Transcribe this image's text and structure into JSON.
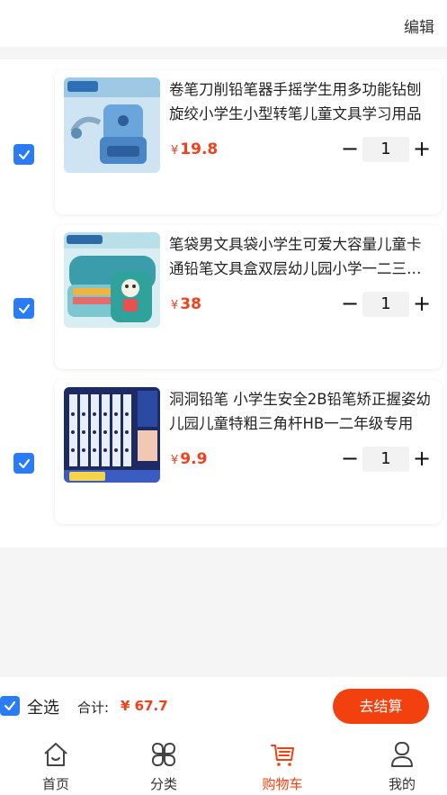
{
  "header": {
    "edit_label": "编辑"
  },
  "cart": {
    "items": [
      {
        "title": "卷笔刀削铅笔器手摇学生用多功能钻刨旋绞小学生小型转笔儿童文具学习用品",
        "currency": "¥",
        "price": "19.8",
        "quantity": "1",
        "checked": true,
        "image": "pencil-sharpener"
      },
      {
        "title": "笔袋男文具袋小学生可爱大容量儿童卡通铅笔文具盒双层幼儿园小学一二三年级",
        "currency": "¥",
        "price": "38",
        "quantity": "1",
        "checked": true,
        "image": "pencil-case"
      },
      {
        "title": "洞洞铅笔 小学生安全2B铅笔矫正握姿幼儿园儿童特粗三角杆HB一二年级专用",
        "currency": "¥",
        "price": "9.9",
        "quantity": "1",
        "checked": true,
        "image": "pencils"
      }
    ],
    "minus_symbol": "−",
    "plus_symbol": "+"
  },
  "bottom_bar": {
    "select_all_label": "全选",
    "total_label": "合计:",
    "total_value": "¥ 67.7",
    "checkout_label": "去结算"
  },
  "tabbar": {
    "tabs": [
      {
        "label": "首页",
        "icon": "home-icon",
        "active": false
      },
      {
        "label": "分类",
        "icon": "category-icon",
        "active": false
      },
      {
        "label": "购物车",
        "icon": "cart-icon",
        "active": true
      },
      {
        "label": "我的",
        "icon": "user-icon",
        "active": false
      }
    ]
  },
  "colors": {
    "accent": "#f3400f",
    "price": "#f2401c",
    "checkbox": "#2a7cf6"
  }
}
